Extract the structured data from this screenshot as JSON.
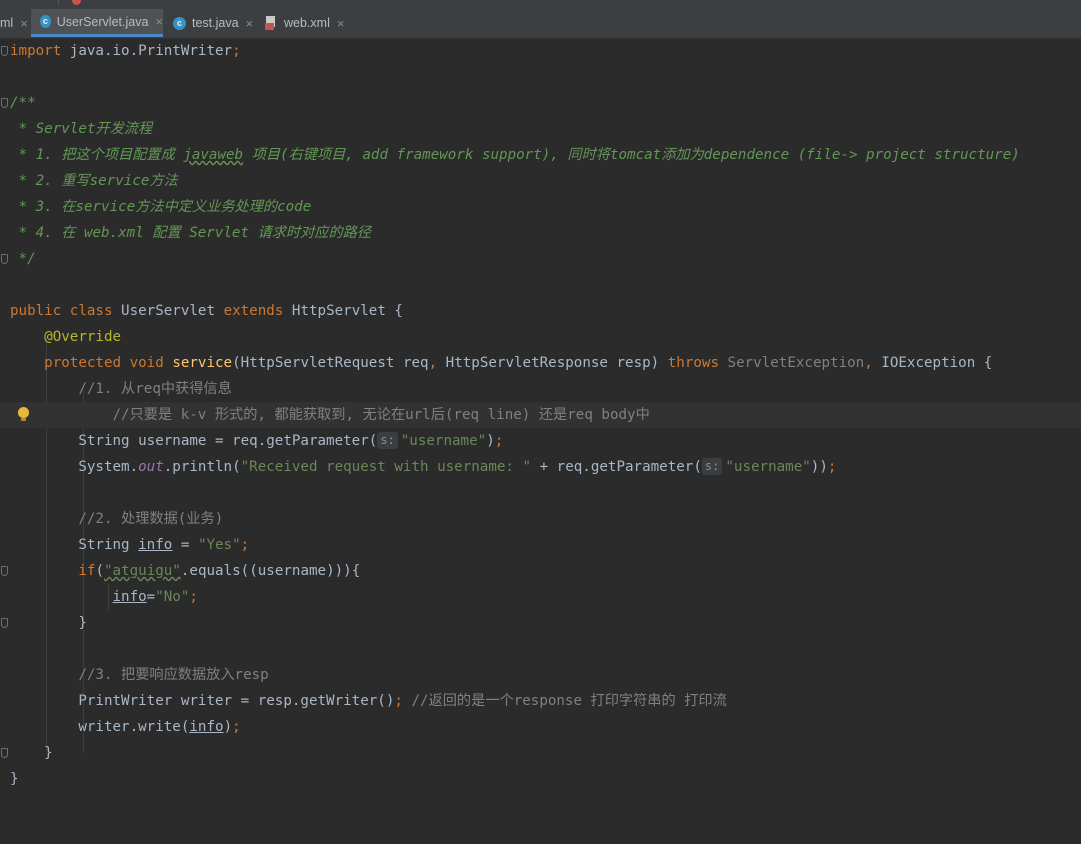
{
  "tabs": [
    {
      "label": "ml",
      "active": false
    },
    {
      "label": "UserServlet.java",
      "active": true,
      "icon": "java-class-icon"
    },
    {
      "label": "test.java",
      "active": false,
      "icon": "java-class-icon"
    },
    {
      "label": "web.xml",
      "active": false,
      "icon": "xml-file-icon"
    }
  ],
  "close_glyph": "×",
  "class_icon_letter": "c",
  "hint_label": "s:",
  "code": {
    "l1": {
      "kw": "import",
      "rest": " java.io.PrintWriter",
      "semi": ";"
    },
    "l3": "/**",
    "l4": " * Servlet开发流程",
    "l5": {
      "a": " * 1. 把这个项目配置成 ",
      "b": "javaweb",
      "c": " 项目(右键项目, add framework support), 同时将tomcat添加为dependence (file-> project structure)"
    },
    "l6": " * 2. 重写service方法",
    "l7": " * 3. 在service方法中定义业务处理的code",
    "l8": " * 4. 在 web.xml 配置 Servlet 请求时对应的路径",
    "l9": " */",
    "l11": {
      "kw1": "public",
      "kw2": "class",
      "name": " UserServlet ",
      "kw3": "extends",
      "rest": " HttpServlet {"
    },
    "l12": "@Override",
    "l13": {
      "kw1": "protected",
      "kw2": "void",
      "fn": "service",
      "p1": "(HttpServletRequest req",
      "comma1": ",",
      "p2": " HttpServletResponse resp) ",
      "kw3": "throws",
      "ex1": " ServletException",
      "comma2": ",",
      "ex2": " IOException {"
    },
    "l14": "//1. 从req中获得信息",
    "l15": "    //只要是 k-v 形式的, 都能获取到, 无论在url后(req line) 还是req body中",
    "l16": {
      "a": "String username = req.getParameter(",
      "s": "\"username\"",
      "b": ")",
      "semi": ";"
    },
    "l17": {
      "a": "System.",
      "out": "out",
      "b": ".println(",
      "s": "\"Received request with username: \"",
      "c": " + req.getParameter(",
      "s2": "\"username\"",
      "d": "))",
      "semi": ";"
    },
    "l19": "//2. 处理数据(业务)",
    "l20": {
      "a": "String ",
      "v": "info",
      "b": " = ",
      "s": "\"Yes\"",
      "semi": ";"
    },
    "l21": {
      "kw": "if",
      "p": "(",
      "s": "\"atguigu\"",
      "rest": ".equals((username))){"
    },
    "l22": {
      "v": "info",
      "eq": "=",
      "s": "\"No\"",
      "semi": ";"
    },
    "l23": "}",
    "l25": "//3. 把要响应数据放入resp",
    "l26": {
      "a": "PrintWriter writer = resp.getWriter()",
      "semi": ";",
      "cm": " //返回的是一个response 打印字符串的 打印流"
    },
    "l27": {
      "a": "writer.write(",
      "v": "info",
      "b": ")",
      "semi": ";"
    },
    "l28": "}",
    "l29": "}"
  }
}
